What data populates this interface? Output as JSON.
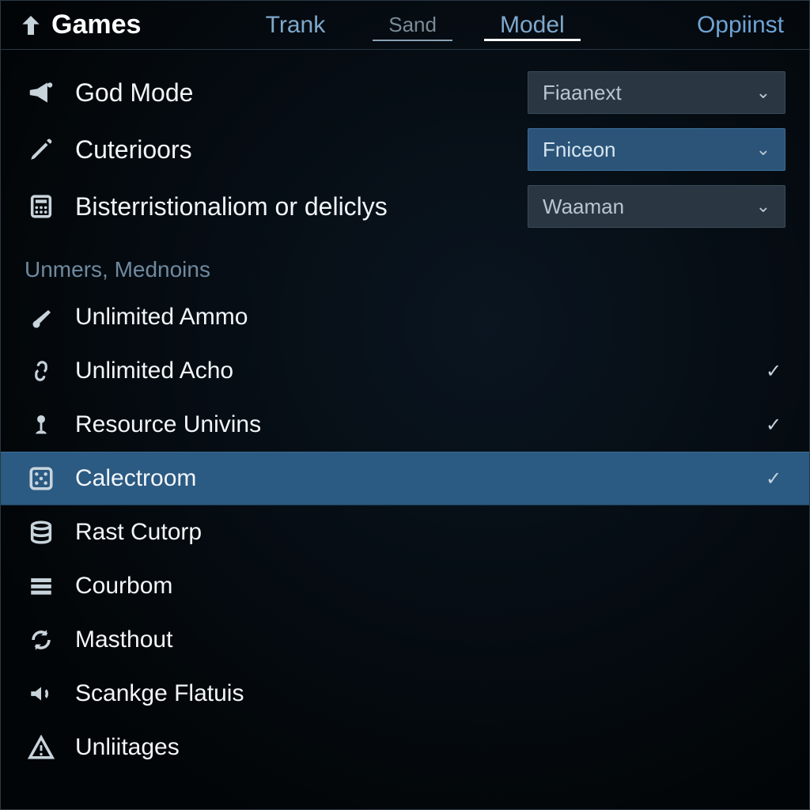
{
  "tabs": {
    "games": "Games",
    "items": [
      {
        "label": "Trank",
        "underline": false,
        "style": "normal"
      },
      {
        "label": "Sand",
        "underline": true,
        "style": "muted"
      },
      {
        "label": "Model",
        "underline": true,
        "style": "active"
      }
    ],
    "right": "Oppiinst"
  },
  "top_options": [
    {
      "icon": "megaphone-icon",
      "label": "God Mode",
      "dropdown": {
        "value": "Fiaanext",
        "active": false
      }
    },
    {
      "icon": "pencil-icon",
      "label": "Cuterioors",
      "dropdown": {
        "value": "Fniceon",
        "active": true
      }
    },
    {
      "icon": "calculator-icon",
      "label": "Bisterristionaliom or deliclys",
      "dropdown": {
        "value": "Waaman",
        "active": false
      }
    }
  ],
  "section_header": "Unmers, Mednoins",
  "cheat_list": [
    {
      "icon": "cannon-icon",
      "label": "Unlimited Ammo",
      "checked": false,
      "selected": false
    },
    {
      "icon": "link-icon",
      "label": "Unlimited Acho",
      "checked": true,
      "selected": false
    },
    {
      "icon": "trophy-icon",
      "label": "Resource Univins",
      "checked": true,
      "selected": false
    },
    {
      "icon": "dice-icon",
      "label": "Calectroom",
      "checked": true,
      "selected": true
    },
    {
      "icon": "stack-icon",
      "label": "Rast Cutorp",
      "checked": false,
      "selected": false
    },
    {
      "icon": "bars-icon",
      "label": "Courbom",
      "checked": false,
      "selected": false
    },
    {
      "icon": "refresh-icon",
      "label": "Masthout",
      "checked": false,
      "selected": false
    },
    {
      "icon": "volume-icon",
      "label": "Scankge Flatuis",
      "checked": false,
      "selected": false
    },
    {
      "icon": "warning-icon",
      "label": "Unliitages",
      "checked": false,
      "selected": false
    }
  ],
  "colors": {
    "accent": "#2b5a82",
    "text": "#e8eef2",
    "muted": "#6f8aa0"
  }
}
